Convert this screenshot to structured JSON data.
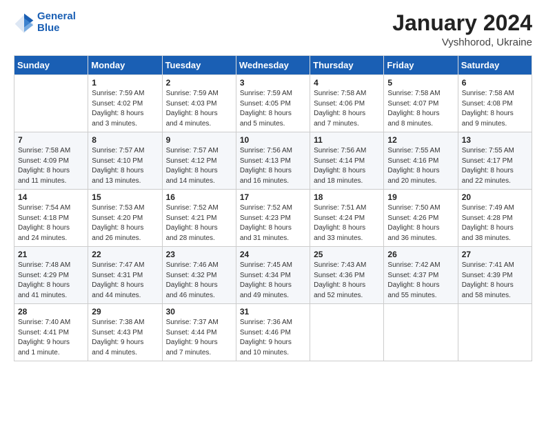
{
  "logo": {
    "line1": "General",
    "line2": "Blue"
  },
  "title": "January 2024",
  "location": "Vyshhorod, Ukraine",
  "weekdays": [
    "Sunday",
    "Monday",
    "Tuesday",
    "Wednesday",
    "Thursday",
    "Friday",
    "Saturday"
  ],
  "weeks": [
    [
      {
        "day": "",
        "detail": ""
      },
      {
        "day": "1",
        "detail": "Sunrise: 7:59 AM\nSunset: 4:02 PM\nDaylight: 8 hours\nand 3 minutes."
      },
      {
        "day": "2",
        "detail": "Sunrise: 7:59 AM\nSunset: 4:03 PM\nDaylight: 8 hours\nand 4 minutes."
      },
      {
        "day": "3",
        "detail": "Sunrise: 7:59 AM\nSunset: 4:05 PM\nDaylight: 8 hours\nand 5 minutes."
      },
      {
        "day": "4",
        "detail": "Sunrise: 7:58 AM\nSunset: 4:06 PM\nDaylight: 8 hours\nand 7 minutes."
      },
      {
        "day": "5",
        "detail": "Sunrise: 7:58 AM\nSunset: 4:07 PM\nDaylight: 8 hours\nand 8 minutes."
      },
      {
        "day": "6",
        "detail": "Sunrise: 7:58 AM\nSunset: 4:08 PM\nDaylight: 8 hours\nand 9 minutes."
      }
    ],
    [
      {
        "day": "7",
        "detail": "Sunrise: 7:58 AM\nSunset: 4:09 PM\nDaylight: 8 hours\nand 11 minutes."
      },
      {
        "day": "8",
        "detail": "Sunrise: 7:57 AM\nSunset: 4:10 PM\nDaylight: 8 hours\nand 13 minutes."
      },
      {
        "day": "9",
        "detail": "Sunrise: 7:57 AM\nSunset: 4:12 PM\nDaylight: 8 hours\nand 14 minutes."
      },
      {
        "day": "10",
        "detail": "Sunrise: 7:56 AM\nSunset: 4:13 PM\nDaylight: 8 hours\nand 16 minutes."
      },
      {
        "day": "11",
        "detail": "Sunrise: 7:56 AM\nSunset: 4:14 PM\nDaylight: 8 hours\nand 18 minutes."
      },
      {
        "day": "12",
        "detail": "Sunrise: 7:55 AM\nSunset: 4:16 PM\nDaylight: 8 hours\nand 20 minutes."
      },
      {
        "day": "13",
        "detail": "Sunrise: 7:55 AM\nSunset: 4:17 PM\nDaylight: 8 hours\nand 22 minutes."
      }
    ],
    [
      {
        "day": "14",
        "detail": "Sunrise: 7:54 AM\nSunset: 4:18 PM\nDaylight: 8 hours\nand 24 minutes."
      },
      {
        "day": "15",
        "detail": "Sunrise: 7:53 AM\nSunset: 4:20 PM\nDaylight: 8 hours\nand 26 minutes."
      },
      {
        "day": "16",
        "detail": "Sunrise: 7:52 AM\nSunset: 4:21 PM\nDaylight: 8 hours\nand 28 minutes."
      },
      {
        "day": "17",
        "detail": "Sunrise: 7:52 AM\nSunset: 4:23 PM\nDaylight: 8 hours\nand 31 minutes."
      },
      {
        "day": "18",
        "detail": "Sunrise: 7:51 AM\nSunset: 4:24 PM\nDaylight: 8 hours\nand 33 minutes."
      },
      {
        "day": "19",
        "detail": "Sunrise: 7:50 AM\nSunset: 4:26 PM\nDaylight: 8 hours\nand 36 minutes."
      },
      {
        "day": "20",
        "detail": "Sunrise: 7:49 AM\nSunset: 4:28 PM\nDaylight: 8 hours\nand 38 minutes."
      }
    ],
    [
      {
        "day": "21",
        "detail": "Sunrise: 7:48 AM\nSunset: 4:29 PM\nDaylight: 8 hours\nand 41 minutes."
      },
      {
        "day": "22",
        "detail": "Sunrise: 7:47 AM\nSunset: 4:31 PM\nDaylight: 8 hours\nand 44 minutes."
      },
      {
        "day": "23",
        "detail": "Sunrise: 7:46 AM\nSunset: 4:32 PM\nDaylight: 8 hours\nand 46 minutes."
      },
      {
        "day": "24",
        "detail": "Sunrise: 7:45 AM\nSunset: 4:34 PM\nDaylight: 8 hours\nand 49 minutes."
      },
      {
        "day": "25",
        "detail": "Sunrise: 7:43 AM\nSunset: 4:36 PM\nDaylight: 8 hours\nand 52 minutes."
      },
      {
        "day": "26",
        "detail": "Sunrise: 7:42 AM\nSunset: 4:37 PM\nDaylight: 8 hours\nand 55 minutes."
      },
      {
        "day": "27",
        "detail": "Sunrise: 7:41 AM\nSunset: 4:39 PM\nDaylight: 8 hours\nand 58 minutes."
      }
    ],
    [
      {
        "day": "28",
        "detail": "Sunrise: 7:40 AM\nSunset: 4:41 PM\nDaylight: 9 hours\nand 1 minute."
      },
      {
        "day": "29",
        "detail": "Sunrise: 7:38 AM\nSunset: 4:43 PM\nDaylight: 9 hours\nand 4 minutes."
      },
      {
        "day": "30",
        "detail": "Sunrise: 7:37 AM\nSunset: 4:44 PM\nDaylight: 9 hours\nand 7 minutes."
      },
      {
        "day": "31",
        "detail": "Sunrise: 7:36 AM\nSunset: 4:46 PM\nDaylight: 9 hours\nand 10 minutes."
      },
      {
        "day": "",
        "detail": ""
      },
      {
        "day": "",
        "detail": ""
      },
      {
        "day": "",
        "detail": ""
      }
    ]
  ]
}
